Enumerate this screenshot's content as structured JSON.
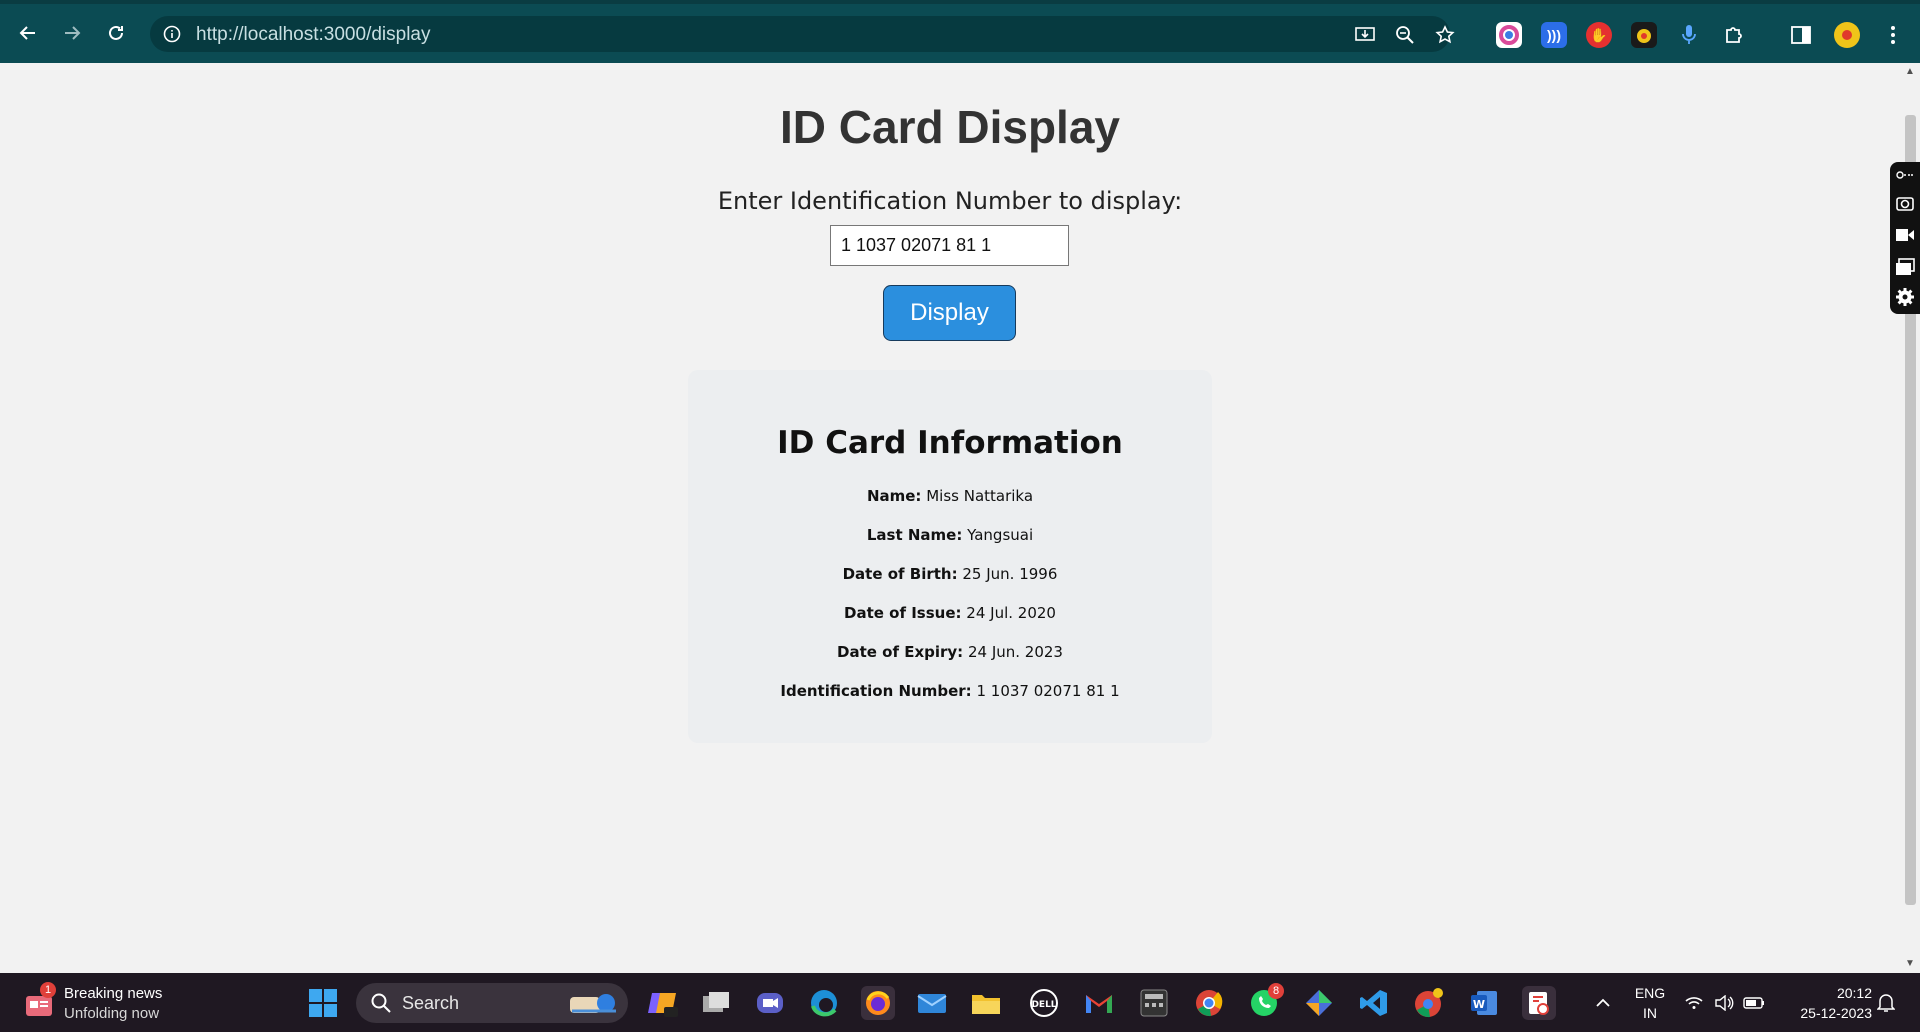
{
  "browser": {
    "url": "http://localhost:3000/display"
  },
  "page": {
    "title": "ID Card Display",
    "prompt": "Enter Identification Number to display:",
    "input_value": "1 1037 02071 81 1",
    "button_label": "Display"
  },
  "card": {
    "title": "ID Card Information",
    "rows": [
      {
        "label": "Name:",
        "value": "Miss Nattarika"
      },
      {
        "label": "Last Name:",
        "value": "Yangsuai"
      },
      {
        "label": "Date of Birth:",
        "value": "25 Jun. 1996"
      },
      {
        "label": "Date of Issue:",
        "value": "24 Jul. 2020"
      },
      {
        "label": "Date of Expiry:",
        "value": "24 Jun. 2023"
      },
      {
        "label": "Identification Number:",
        "value": "1 1037 02071 81 1"
      }
    ]
  },
  "taskbar": {
    "news_title": "Breaking news",
    "news_subtitle": "Unfolding now",
    "news_badge": "1",
    "search_label": "Search",
    "whatsapp_badge": "8",
    "lang_line1": "ENG",
    "lang_line2": "IN",
    "time": "20:12",
    "date": "25-12-2023"
  },
  "colors": {
    "chrome": "#0b4b53",
    "button": "#2b8fde",
    "card_bg": "#eceef0",
    "page_bg": "#f2f2f2"
  }
}
